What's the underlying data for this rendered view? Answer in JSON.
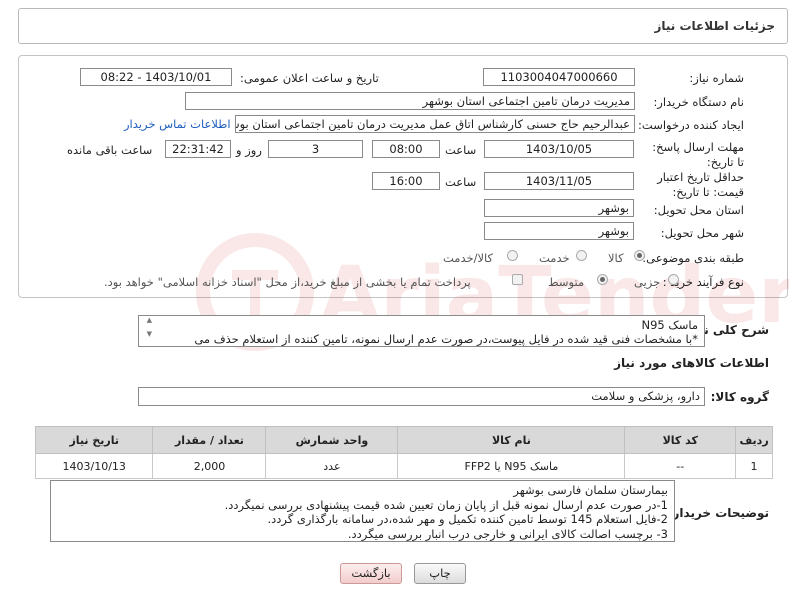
{
  "header": {
    "title": "جزئیات اطلاعات نیاز"
  },
  "form": {
    "need_number_label": "شماره نیاز:",
    "need_number": "1103004047000660",
    "announce_label": "تاریخ و ساعت اعلان عمومی:",
    "announce_value": "1403/10/01 - 08:22",
    "buyer_org_label": "نام دستگاه خریدار:",
    "buyer_org": "مدیریت درمان تامین اجتماعی استان بوشهر",
    "creator_label": "ایجاد کننده درخواست:",
    "creator": "عبدالرحیم حاج حسنی کارشناس اتاق عمل مدیریت درمان تامین اجتماعی استان بوشهر",
    "contact_link": "اطلاعات تماس خریدار",
    "reply_deadline_label": "مهلت ارسال پاسخ: تا تاریخ:",
    "reply_date": "1403/10/05",
    "time_word": "ساعت",
    "reply_time": "08:00",
    "days_value": "3",
    "days_word": "روز و",
    "remaining_time": "22:31:42",
    "remaining_word": "ساعت باقی مانده",
    "validity_label": "حداقل تاریخ اعتبار قیمت: تا تاریخ:",
    "validity_date": "1403/11/05",
    "validity_time": "16:00",
    "province_label": "استان محل تحویل:",
    "province": "بوشهر",
    "city_label": "شهر محل تحویل:",
    "city": "بوشهر",
    "category_label": "طبقه بندی موضوعی:",
    "category_options": [
      "کالا",
      "خدمت",
      "کالا/خدمت"
    ],
    "process_label": "نوع فرآیند خرید :",
    "process_options": [
      "جزیی",
      "متوسط"
    ],
    "payment_note": "پرداخت تمام یا بخشی از مبلغ خرید،از محل \"اسناد خزانه اسلامی\" خواهد بود."
  },
  "summary": {
    "label": "شرح کلی نیاز:",
    "line1": "ماسک N95",
    "line2": "*با مشخصات فنی قید شده در فایل پیوست،در صورت عدم ارسال نمونه، تامین کننده از استعلام حذف می"
  },
  "goods": {
    "section_title": "اطلاعات کالاهای مورد نیاز",
    "group_label": "گروه کالا:",
    "group_value": "دارو، پزشکی و سلامت",
    "columns": [
      "ردیف",
      "کد کالا",
      "نام کالا",
      "واحد شمارش",
      "تعداد / مقدار",
      "تاریخ نیاز"
    ],
    "rows": [
      [
        "1",
        "--",
        "ماسک N95 یا FFP2",
        "عدد",
        "2,000",
        "1403/10/13"
      ]
    ]
  },
  "buyer_notes": {
    "label": "توضیحات خریدار:",
    "lines": [
      "بیمارستان سلمان فارسی بوشهر",
      "1-در صورت عدم ارسال نمونه قبل از پایان زمان تعیین شده قیمت پیشنهادی بررسی نمیگردد.",
      "2-فایل استعلام 145 توسط تامین کننده تکمیل و مهر شده،در سامانه بارگذاری گردد.",
      "3- برچسب اصالت کالای ایرانی و خارجی درب انبار بررسی میگردد."
    ]
  },
  "buttons": {
    "print": "چاپ",
    "back": "بازگشت"
  },
  "watermark": {
    "text": "AriaTender.neT"
  }
}
